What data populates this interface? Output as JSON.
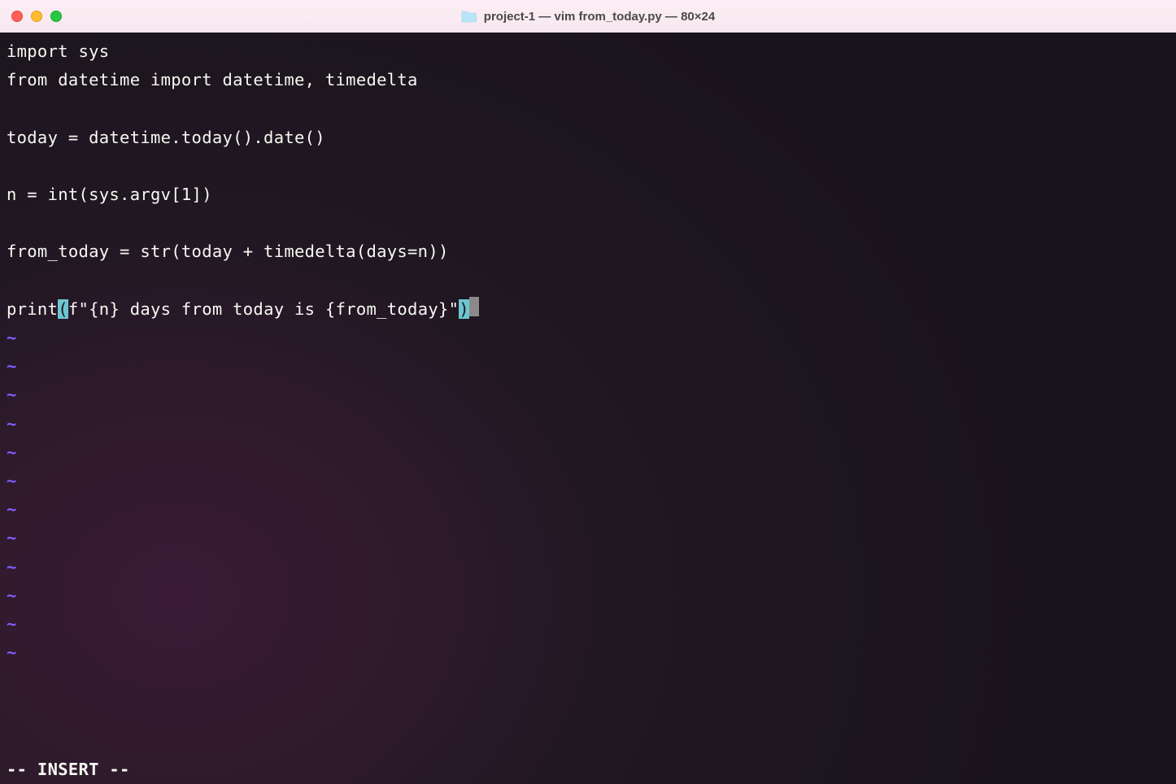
{
  "titlebar": {
    "title": "project-1 — vim from_today.py — 80×24"
  },
  "editor": {
    "lines": [
      "import sys",
      "from datetime import datetime, timedelta",
      "",
      "today = datetime.today().date()",
      "",
      "n = int(sys.argv[1])",
      "",
      "from_today = str(today + timedelta(days=n))",
      ""
    ],
    "print_prefix": "print",
    "print_open_paren": "(",
    "print_mid": "f\"{n} days from today is {from_today}\"",
    "print_close_paren": ")",
    "tilde": "~",
    "tilde_count": 12,
    "status": "-- INSERT --"
  }
}
